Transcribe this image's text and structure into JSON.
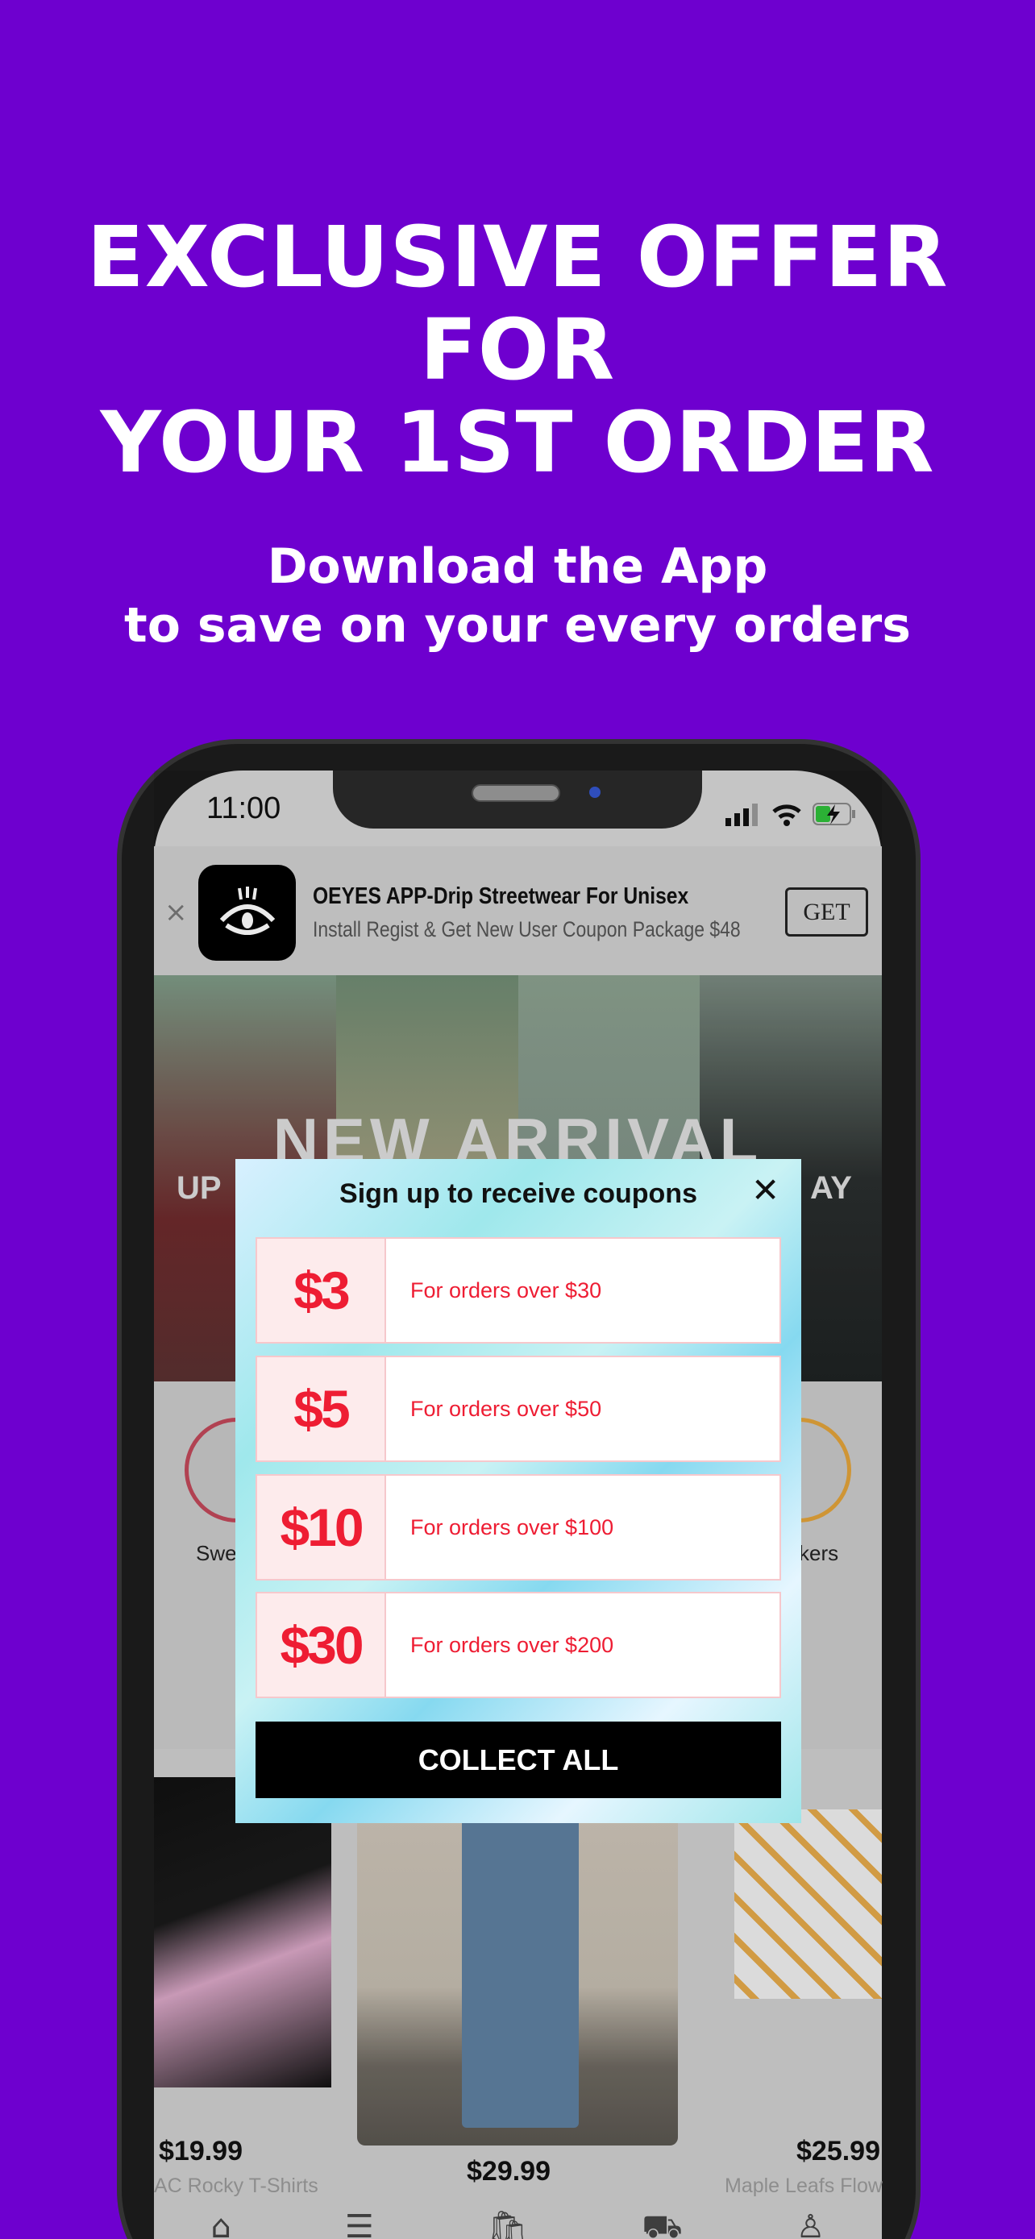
{
  "promo": {
    "headline": [
      "EXCLUSIVE OFFER",
      "FOR",
      "YOUR 1ST ORDER"
    ],
    "subheadline": [
      "Download the App",
      "to save on your every orders"
    ],
    "background_color": "#6e00cf"
  },
  "status_bar": {
    "time": "11:00"
  },
  "app_banner": {
    "title": "OEYES APP-Drip Streetwear For Unisex",
    "subtitle": "Install Regist & Get New User Coupon Package $48",
    "get_label": "GET",
    "close_label": "×"
  },
  "hero": {
    "title": "NEW ARRIVAL",
    "left_fragment": "UP",
    "right_fragment": "AY"
  },
  "categories": [
    {
      "label": "Swe"
    },
    {
      "label": "kers"
    }
  ],
  "popup": {
    "title": "Sign up to receive coupons",
    "close_label": "✕",
    "coupons": [
      {
        "amount": "$3",
        "condition": "For orders over $30"
      },
      {
        "amount": "$5",
        "condition": "For orders over $50"
      },
      {
        "amount": "$10",
        "condition": "For orders over $100"
      },
      {
        "amount": "$30",
        "condition": "For orders over $200"
      }
    ],
    "collect_label": "COLLECT ALL",
    "accent_color": "#ee1d33"
  },
  "products": [
    {
      "price": "$19.99",
      "name": "AC Rocky T-Shirts"
    },
    {
      "price": "$29.99",
      "name": ""
    },
    {
      "price": "$25.99",
      "name": "Maple Leafs Flow"
    }
  ],
  "nav": [
    "home-icon",
    "menu-icon",
    "bag-icon",
    "cart-icon",
    "user-icon"
  ]
}
